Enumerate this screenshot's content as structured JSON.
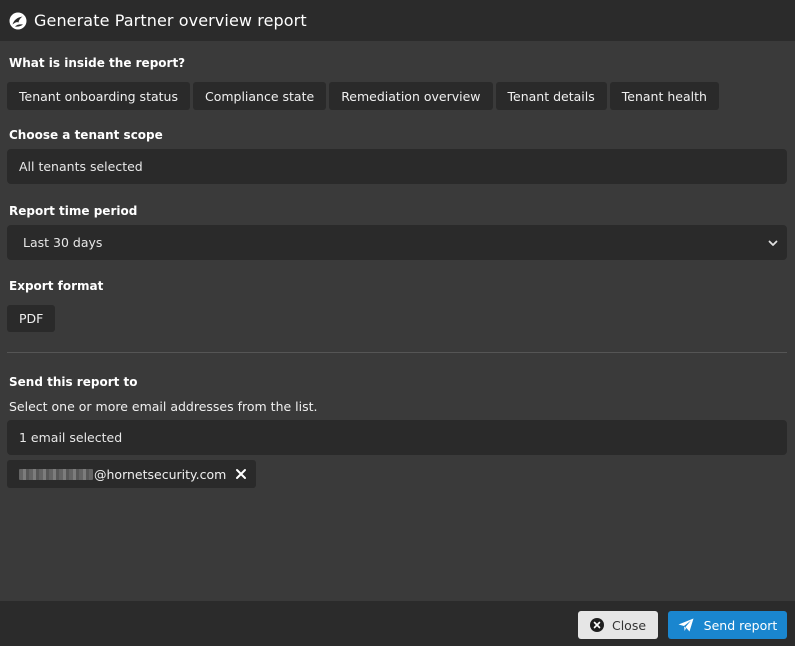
{
  "dialog": {
    "title": "Generate Partner overview report",
    "header_icon": "brand-logo-icon"
  },
  "report_contents": {
    "label": "What is inside the report?",
    "items": [
      "Tenant onboarding status",
      "Compliance state",
      "Remediation overview",
      "Tenant details",
      "Tenant health"
    ]
  },
  "tenant_scope": {
    "label": "Choose a tenant scope",
    "value": "All tenants selected"
  },
  "time_period": {
    "label": "Report time period",
    "value": "Last 30 days",
    "icon": "chevron-down-icon"
  },
  "export_format": {
    "label": "Export format",
    "value": "PDF"
  },
  "recipients": {
    "label": "Send this report to",
    "helper": "Select one or more email addresses from the list.",
    "summary": "1 email selected",
    "email_domain": "@hornetsecurity.com",
    "remove_icon": "close-x-icon"
  },
  "footer": {
    "close_label": "Close",
    "close_icon": "circle-x-icon",
    "send_label": "Send report",
    "send_icon": "paper-plane-icon"
  },
  "colors": {
    "header_bg": "#2b2b2b",
    "body_bg": "#3a3a3a",
    "chip_bg": "#2a2a2a",
    "primary": "#1a86cf",
    "secondary_btn": "#e6e6e6"
  }
}
